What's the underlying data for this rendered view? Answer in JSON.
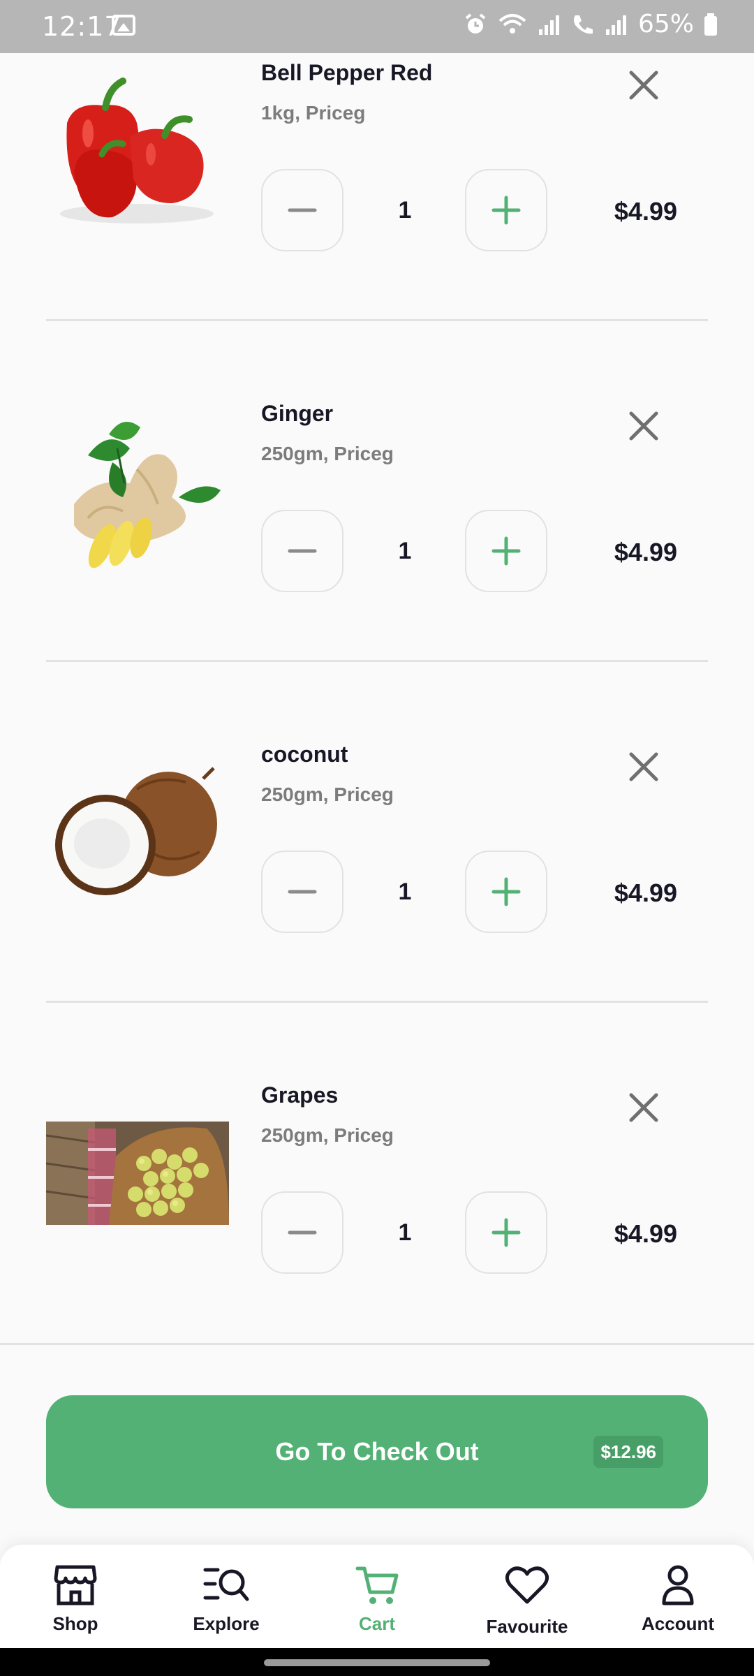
{
  "status_bar": {
    "time": "12:17",
    "battery": "65%"
  },
  "cart": {
    "items": [
      {
        "name": "Bell Pepper Red",
        "description": "1kg, Priceg",
        "quantity": "1",
        "price": "$4.99",
        "image": "bell-pepper-image"
      },
      {
        "name": "Ginger",
        "description": "250gm, Priceg",
        "quantity": "1",
        "price": "$4.99",
        "image": "ginger-image"
      },
      {
        "name": "coconut",
        "description": "250gm, Priceg",
        "quantity": "1",
        "price": "$4.99",
        "image": "coconut-image"
      },
      {
        "name": "Grapes",
        "description": "250gm, Priceg",
        "quantity": "1",
        "price": "$4.99",
        "image": "grapes-image"
      }
    ]
  },
  "checkout": {
    "label": "Go To Check Out",
    "total": "$12.96"
  },
  "nav": {
    "items": [
      {
        "label": "Shop",
        "icon": "store-icon"
      },
      {
        "label": "Explore",
        "icon": "explore-icon"
      },
      {
        "label": "Cart",
        "icon": "cart-icon"
      },
      {
        "label": "Favourite",
        "icon": "heart-icon"
      },
      {
        "label": "Account",
        "icon": "person-icon"
      }
    ],
    "active": "Cart"
  },
  "colors": {
    "accent": "#53b175",
    "text": "#181725",
    "muted": "#7c7c7c",
    "divider": "#e2e2e2"
  }
}
